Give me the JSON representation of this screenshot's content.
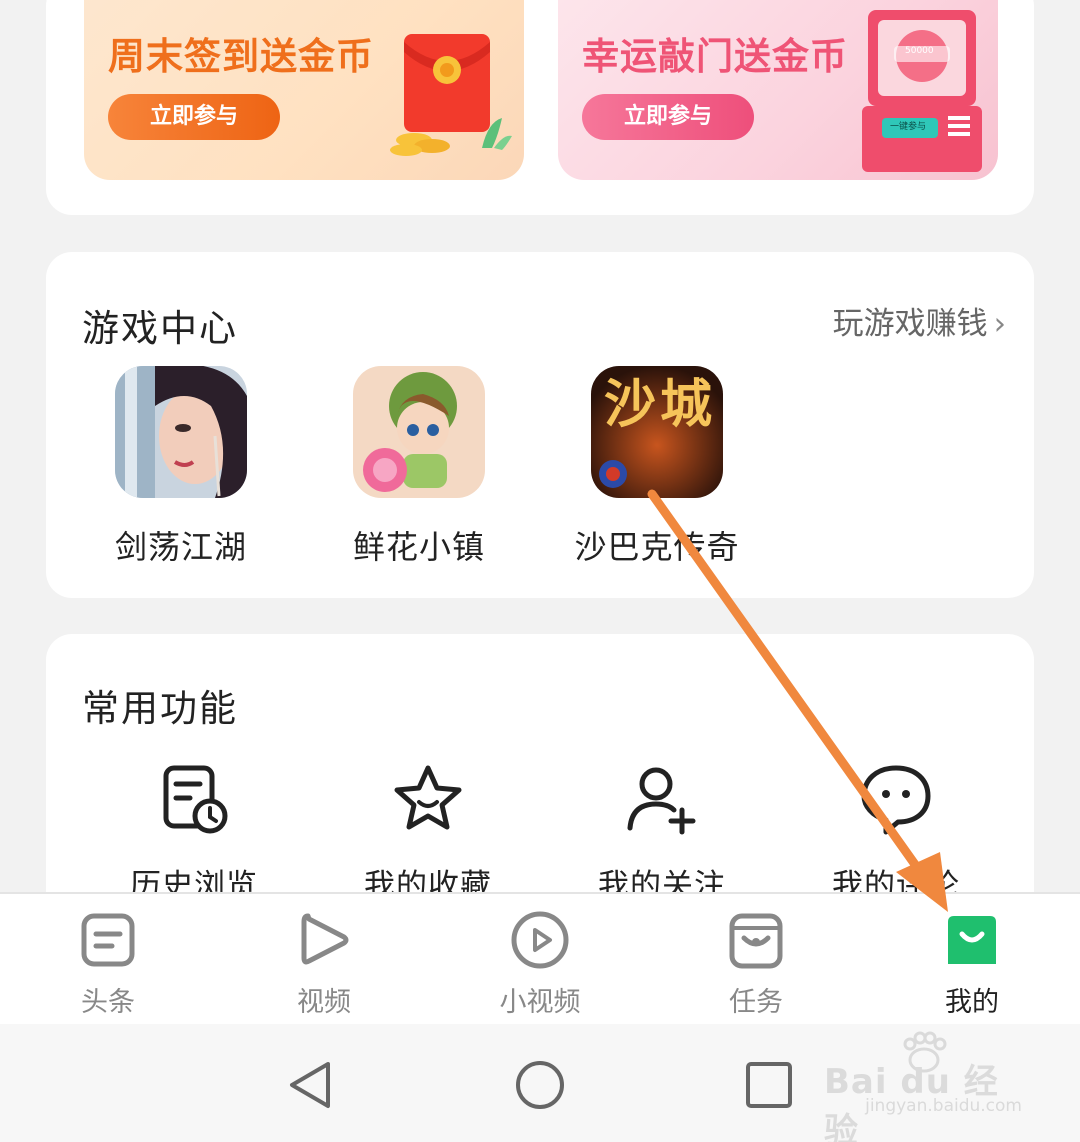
{
  "promos": [
    {
      "title": "周末签到送金币",
      "button": "立即参与"
    },
    {
      "title": "幸运敲门送金币",
      "button": "立即参与",
      "machine_amount": "50000",
      "machine_button": "一键参与"
    }
  ],
  "game_center": {
    "title": "游戏中心",
    "link": "玩游戏赚钱",
    "games": [
      {
        "name": "剑荡江湖"
      },
      {
        "name": "鲜花小镇"
      },
      {
        "name": "沙巴克传奇",
        "icon_text": "沙城"
      }
    ]
  },
  "common_functions": {
    "title": "常用功能",
    "items": [
      {
        "label": "历史浏览",
        "icon": "history-icon"
      },
      {
        "label": "我的收藏",
        "icon": "favorite-star-icon"
      },
      {
        "label": "我的关注",
        "icon": "follow-user-icon"
      },
      {
        "label": "我的评论",
        "icon": "comment-icon"
      }
    ]
  },
  "bottom_nav": {
    "items": [
      {
        "label": "头条",
        "icon": "headline-icon"
      },
      {
        "label": "视频",
        "icon": "video-play-icon"
      },
      {
        "label": "小视频",
        "icon": "short-video-icon"
      },
      {
        "label": "任务",
        "icon": "task-icon"
      },
      {
        "label": "我的",
        "icon": "profile-icon",
        "active": true
      }
    ],
    "active_color": "#1fbf6e"
  },
  "watermark": {
    "logo": "Bai du 经验",
    "url": "jingyan.baidu.com"
  },
  "colors": {
    "accent_orange": "#ee6414",
    "accent_pink": "#ee4f7b",
    "annotation_arrow": "#f0883e"
  }
}
